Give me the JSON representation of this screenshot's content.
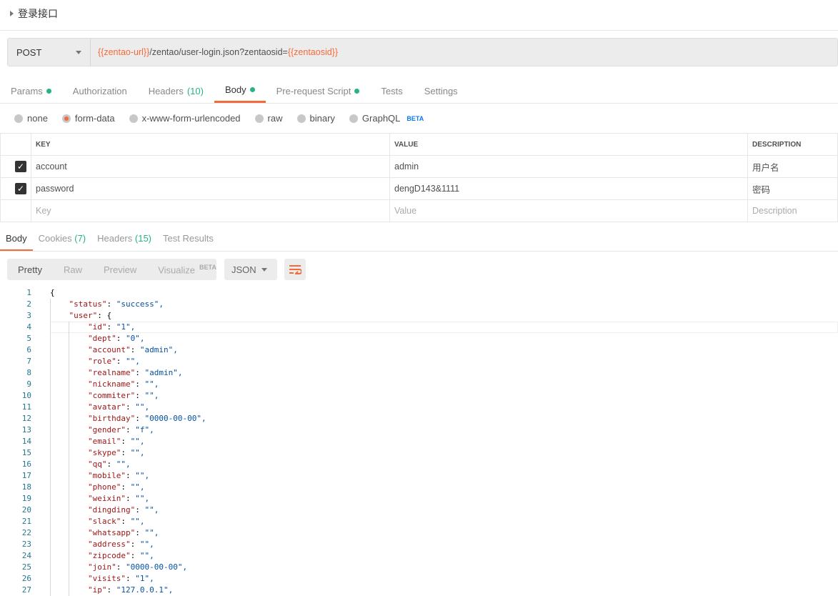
{
  "request_title": "登录接口",
  "method": "POST",
  "url": {
    "var1": "{{zentao-url}}",
    "path": "/zentao/user-login.json?zentaosid=",
    "var2": "{{zentaosid}}"
  },
  "request_tabs": [
    {
      "label": "Params",
      "dot": true
    },
    {
      "label": "Authorization"
    },
    {
      "label": "Headers",
      "count": "(10)"
    },
    {
      "label": "Body",
      "dot": true,
      "active": true
    },
    {
      "label": "Pre-request Script",
      "dot": true
    },
    {
      "label": "Tests"
    },
    {
      "label": "Settings"
    }
  ],
  "body_types": [
    "none",
    "form-data",
    "x-www-form-urlencoded",
    "raw",
    "binary",
    "GraphQL"
  ],
  "beta": "BETA",
  "table": {
    "headers": [
      "KEY",
      "VALUE",
      "DESCRIPTION"
    ],
    "rows": [
      {
        "key": "account",
        "value": "admin",
        "desc": "用户名"
      },
      {
        "key": "password",
        "value": "dengD143&1111",
        "desc": "密码"
      }
    ],
    "placeholders": {
      "key": "Key",
      "value": "Value",
      "desc": "Description"
    }
  },
  "response_tabs": [
    {
      "label": "Body"
    },
    {
      "label": "Cookies",
      "count": "(7)"
    },
    {
      "label": "Headers",
      "count": "(15)"
    },
    {
      "label": "Test Results"
    }
  ],
  "format_tabs": [
    "Pretty",
    "Raw",
    "Preview",
    "Visualize"
  ],
  "format": "JSON",
  "code_lines": [
    {
      "i": 0,
      "t": "{"
    },
    {
      "i": 1,
      "k": "status",
      "v": "\"success\","
    },
    {
      "i": 1,
      "k": "user",
      "v": "{"
    },
    {
      "i": 2,
      "k": "id",
      "v": "\"1\","
    },
    {
      "i": 2,
      "k": "dept",
      "v": "\"0\","
    },
    {
      "i": 2,
      "k": "account",
      "v": "\"admin\","
    },
    {
      "i": 2,
      "k": "role",
      "v": "\"\","
    },
    {
      "i": 2,
      "k": "realname",
      "v": "\"admin\","
    },
    {
      "i": 2,
      "k": "nickname",
      "v": "\"\","
    },
    {
      "i": 2,
      "k": "commiter",
      "v": "\"\","
    },
    {
      "i": 2,
      "k": "avatar",
      "v": "\"\","
    },
    {
      "i": 2,
      "k": "birthday",
      "v": "\"0000-00-00\","
    },
    {
      "i": 2,
      "k": "gender",
      "v": "\"f\","
    },
    {
      "i": 2,
      "k": "email",
      "v": "\"\","
    },
    {
      "i": 2,
      "k": "skype",
      "v": "\"\","
    },
    {
      "i": 2,
      "k": "qq",
      "v": "\"\","
    },
    {
      "i": 2,
      "k": "mobile",
      "v": "\"\","
    },
    {
      "i": 2,
      "k": "phone",
      "v": "\"\","
    },
    {
      "i": 2,
      "k": "weixin",
      "v": "\"\","
    },
    {
      "i": 2,
      "k": "dingding",
      "v": "\"\","
    },
    {
      "i": 2,
      "k": "slack",
      "v": "\"\","
    },
    {
      "i": 2,
      "k": "whatsapp",
      "v": "\"\","
    },
    {
      "i": 2,
      "k": "address",
      "v": "\"\","
    },
    {
      "i": 2,
      "k": "zipcode",
      "v": "\"\","
    },
    {
      "i": 2,
      "k": "join",
      "v": "\"0000-00-00\","
    },
    {
      "i": 2,
      "k": "visits",
      "v": "\"1\","
    },
    {
      "i": 2,
      "k": "ip",
      "v": "\"127.0.0.1\","
    }
  ]
}
